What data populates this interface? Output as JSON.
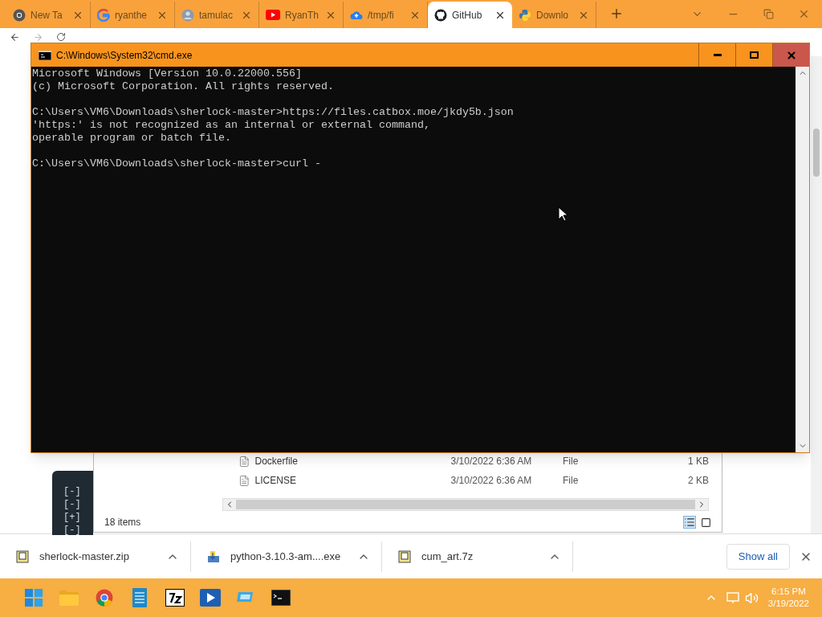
{
  "browser": {
    "tabs": [
      {
        "title": "New Ta",
        "kind": "chrome",
        "selected": false
      },
      {
        "title": "ryanthe",
        "kind": "google",
        "selected": false
      },
      {
        "title": "tamulac",
        "kind": "avatar",
        "selected": false
      },
      {
        "title": "RyanTh",
        "kind": "video",
        "selected": false
      },
      {
        "title": "/tmp/fi",
        "kind": "cloud",
        "selected": false
      },
      {
        "title": "GitHub",
        "kind": "github",
        "selected": true
      },
      {
        "title": "Downlo",
        "kind": "python",
        "selected": false
      }
    ]
  },
  "code_card": {
    "lines": [
      "[-]",
      "[-]",
      "[+]",
      "[-]"
    ]
  },
  "explorer": {
    "rows": [
      {
        "name": "Dockerfile",
        "date": "3/10/2022 6:36 AM",
        "type": "File",
        "size": "1 KB"
      },
      {
        "name": "LICENSE",
        "date": "3/10/2022 6:36 AM",
        "type": "File",
        "size": "2 KB"
      }
    ],
    "status": "18 items"
  },
  "console": {
    "title": "C:\\Windows\\System32\\cmd.exe",
    "blocks": [
      [
        "Microsoft Windows [Version 10.0.22000.556]",
        "(c) Microsoft Corporation. All rights reserved."
      ],
      [
        "C:\\Users\\VM6\\Downloads\\sherlock-master>https://files.catbox.moe/jkdy5b.json",
        "'https:' is not recognized as an internal or external command,",
        "operable program or batch file."
      ],
      [
        "C:\\Users\\VM6\\Downloads\\sherlock-master>curl -"
      ]
    ]
  },
  "downloads": {
    "items": [
      {
        "name": "sherlock-master.zip",
        "kind": "archive"
      },
      {
        "name": "python-3.10.3-am....exe",
        "kind": "installer"
      },
      {
        "name": "cum_art.7z",
        "kind": "archive"
      }
    ],
    "show_all": "Show all"
  },
  "taskbar": {
    "apps": [
      {
        "kind": "start"
      },
      {
        "kind": "folder"
      },
      {
        "kind": "chrome"
      },
      {
        "kind": "notepad"
      },
      {
        "kind": "sevenzip"
      },
      {
        "kind": "player"
      },
      {
        "kind": "remote"
      },
      {
        "kind": "terminal"
      }
    ],
    "time": "6:15 PM",
    "date": "3/19/2022"
  }
}
